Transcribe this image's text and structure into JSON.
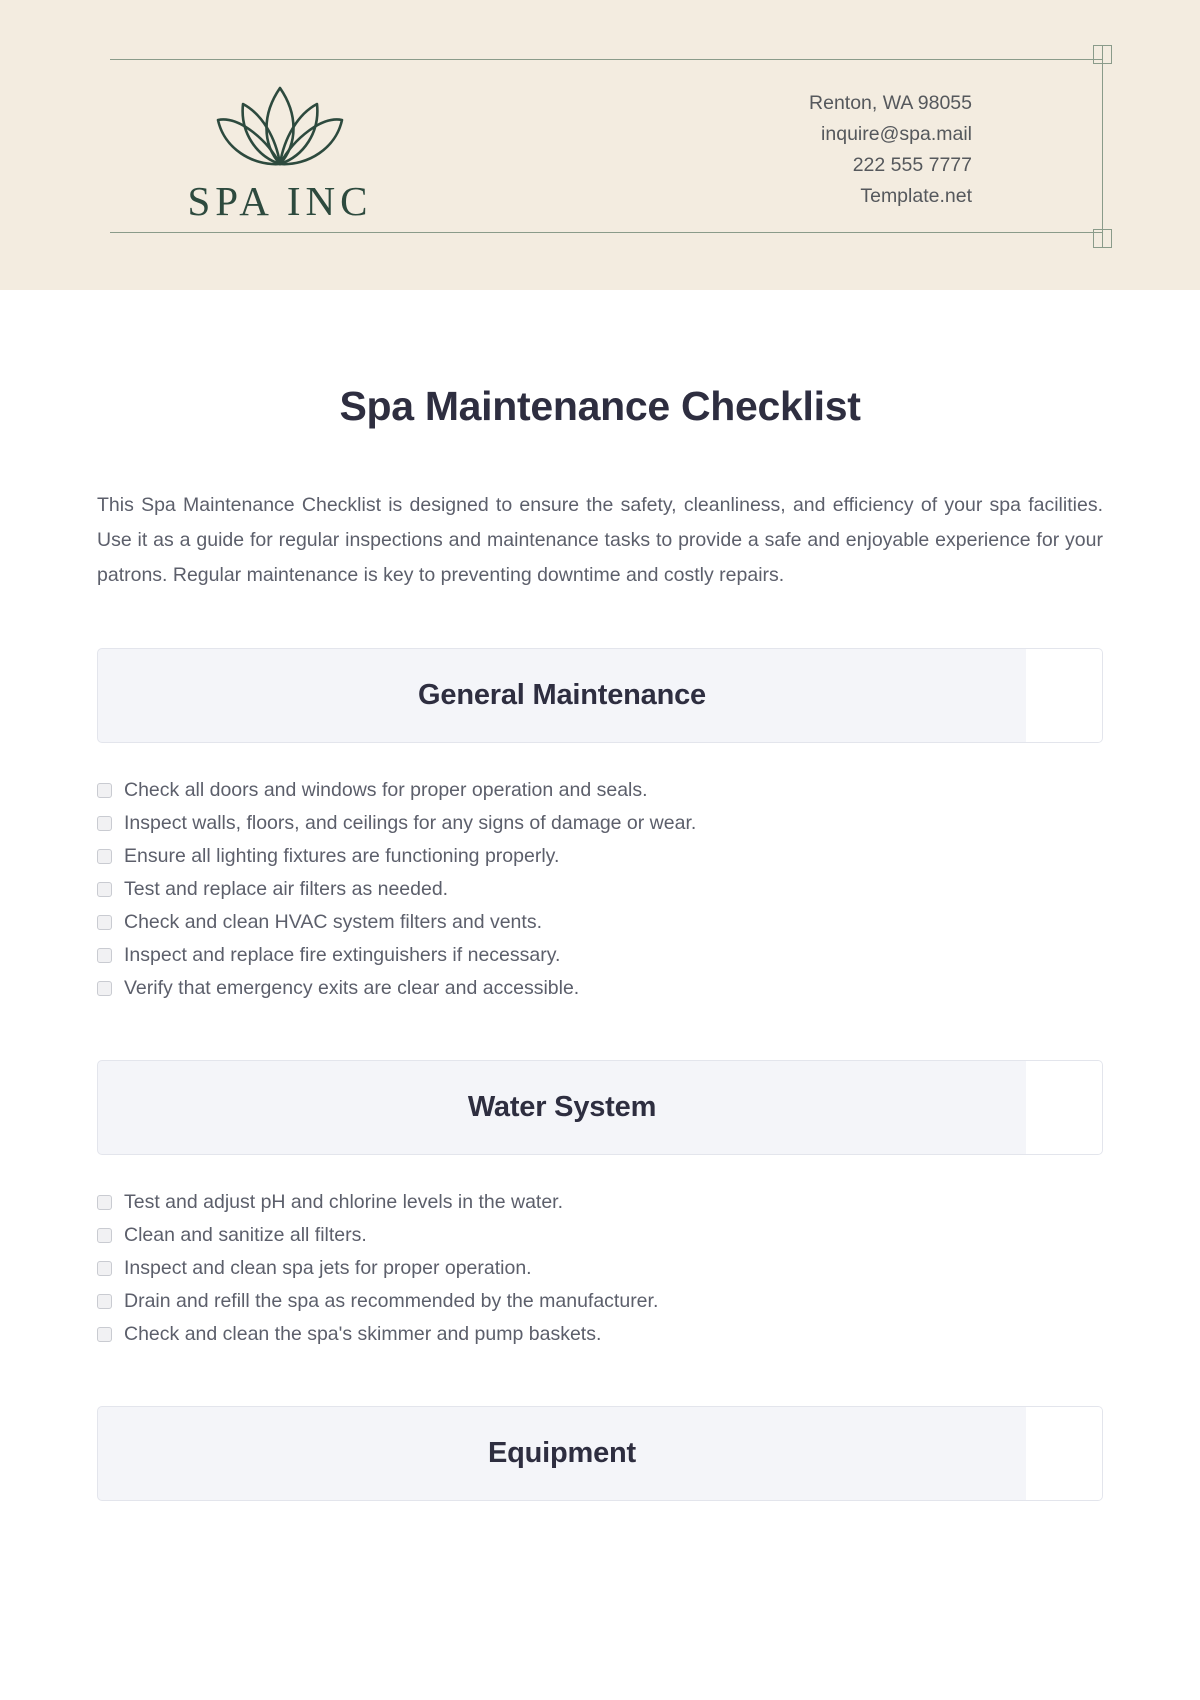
{
  "letterhead": {
    "logo": {
      "icon_name": "lotus-flower-icon",
      "wordmark": "SPA INC",
      "color": "#2d4a3e"
    },
    "contact": [
      "Renton, WA 98055",
      "inquire@spa.mail",
      "222 555 7777",
      "Template.net"
    ],
    "background_color": "#f3ece0",
    "rule_color": "#8a9b8a"
  },
  "document": {
    "title": "Spa Maintenance Checklist",
    "intro": "This Spa Maintenance Checklist is designed to ensure the safety, cleanliness, and efficiency of your spa facilities. Use it as a guide for regular inspections and maintenance tasks to provide a safe and enjoyable experience for your patrons. Regular maintenance is key to preventing downtime and costly repairs.",
    "title_color": "#2e2e40",
    "body_color": "#5c5f6b",
    "section_bar_color": "#f4f5f9"
  },
  "sections": [
    {
      "heading": "General Maintenance",
      "items": [
        "Check all doors and windows for proper operation and seals.",
        "Inspect walls, floors, and ceilings for any signs of damage or wear.",
        "Ensure all lighting fixtures are functioning properly.",
        "Test and replace air filters as needed.",
        "Check and clean HVAC system filters and vents.",
        "Inspect and replace fire extinguishers if necessary.",
        "Verify that emergency exits are clear and accessible."
      ]
    },
    {
      "heading": "Water System",
      "items": [
        "Test and adjust pH and chlorine levels in the water.",
        "Clean and sanitize all filters.",
        "Inspect and clean spa jets for proper operation.",
        "Drain and refill the spa as recommended by the manufacturer.",
        "Check and clean the spa's skimmer and pump baskets."
      ]
    },
    {
      "heading": "Equipment",
      "items": []
    }
  ]
}
